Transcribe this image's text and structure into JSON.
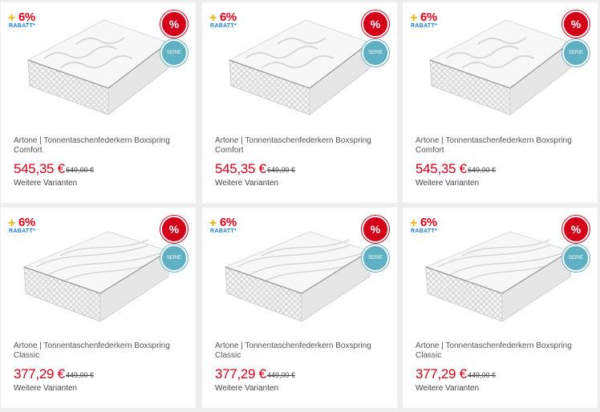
{
  "badges": {
    "rabatt_percent": "6%",
    "rabatt_plus": "+",
    "rabatt_label": "RABATT*",
    "sale_symbol": "%",
    "serie_label": "SERIE"
  },
  "products": [
    {
      "brand_title": "Artone | Tonnentaschenfederkern Boxspring Comfort",
      "price": "545,35 €",
      "old_price": "649,00 €",
      "variants_link": "Weitere Varianten",
      "image": "mattress-comfort"
    },
    {
      "brand_title": "Artone | Tonnentaschenfederkern Boxspring Comfort",
      "price": "545,35 €",
      "old_price": "649,00 €",
      "variants_link": "Weitere Varianten",
      "image": "mattress-comfort"
    },
    {
      "brand_title": "Artone | Tonnentaschenfederkern Boxspring Comfort",
      "price": "545,35 €",
      "old_price": "649,00 €",
      "variants_link": "Weitere Varianten",
      "image": "mattress-comfort"
    },
    {
      "brand_title": "Artone | Tonnentaschenfederkern Boxspring Classic",
      "price": "377,29 €",
      "old_price": "449,00 €",
      "variants_link": "Weitere Varianten",
      "image": "mattress-classic"
    },
    {
      "brand_title": "Artone | Tonnentaschenfederkern Boxspring Classic",
      "price": "377,29 €",
      "old_price": "449,00 €",
      "variants_link": "Weitere Varianten",
      "image": "mattress-classic"
    },
    {
      "brand_title": "Artone | Tonnentaschenfederkern Boxspring Classic",
      "price": "377,29 €",
      "old_price": "449,00 €",
      "variants_link": "Weitere Varianten",
      "image": "mattress-classic"
    }
  ],
  "colors": {
    "price": "#d4001a",
    "sale_badge": "#d4001a",
    "serie_badge": "#5fb0c3",
    "rabatt_blue": "#1a7fd0",
    "rabatt_yellow": "#f2b200"
  }
}
